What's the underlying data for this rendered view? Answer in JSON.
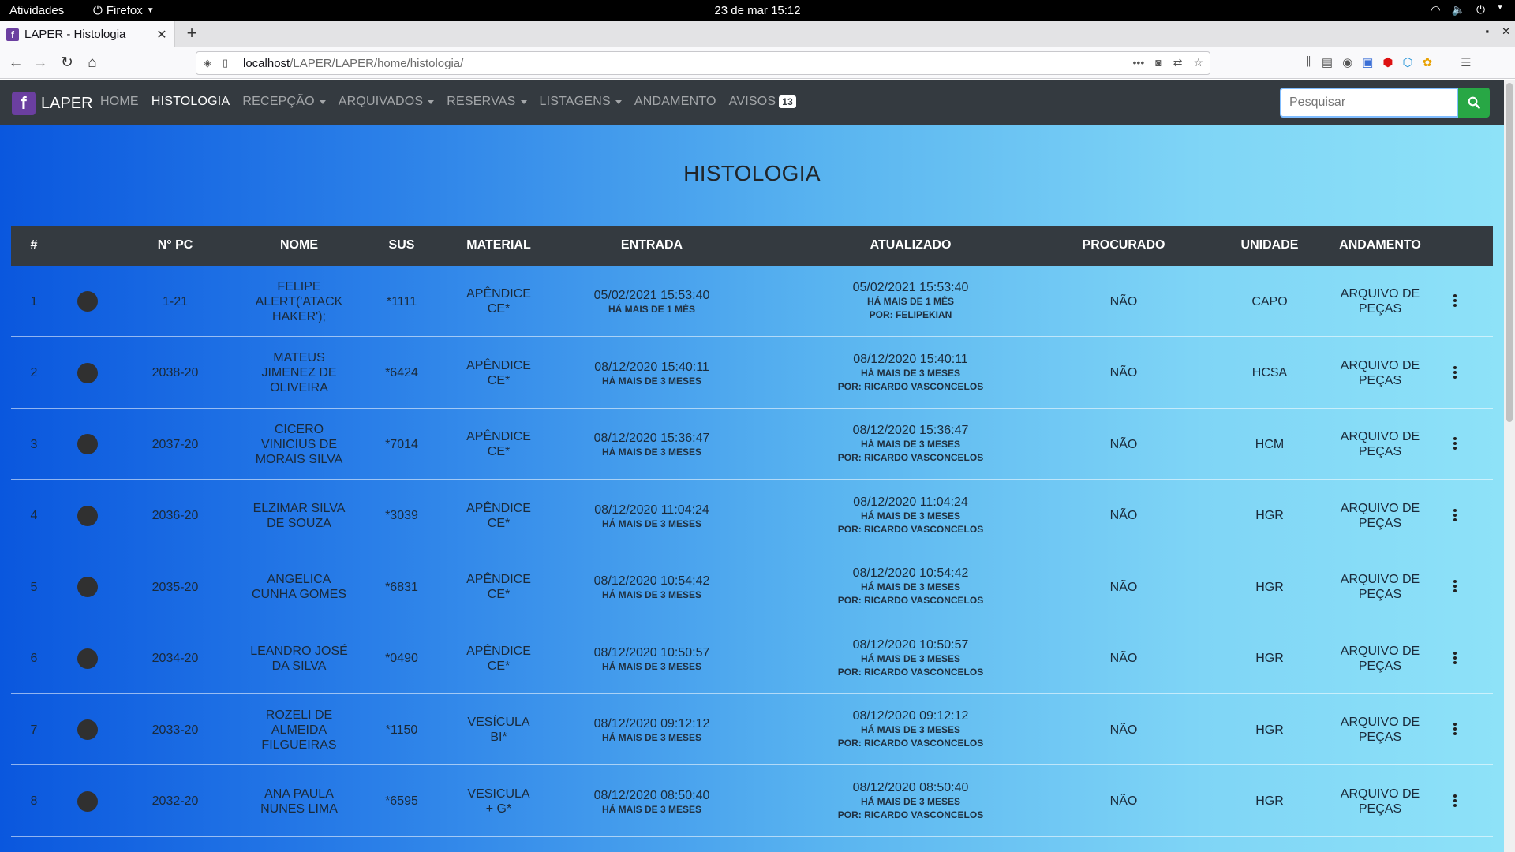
{
  "system_bar": {
    "activities": "Atividades",
    "app_name": "Firefox",
    "clock": "23 de mar  15:12"
  },
  "browser": {
    "tab_title": "LAPER - Histologia",
    "favicon_letter": "f",
    "url_host": "localhost",
    "url_path": "/LAPER/LAPER/home/histologia/"
  },
  "app": {
    "brand": "LAPER",
    "logo_letter": "f",
    "nav": [
      {
        "label": "HOME"
      },
      {
        "label": "HISTOLOGIA"
      },
      {
        "label": "RECEPÇÃO"
      },
      {
        "label": "ARQUIVADOS"
      },
      {
        "label": "RESERVAS"
      },
      {
        "label": "LISTAGENS"
      },
      {
        "label": "ANDAMENTO"
      },
      {
        "label": "AVISOS",
        "badge": "13"
      }
    ],
    "search_placeholder": "Pesquisar",
    "page_title": "HISTOLOGIA"
  },
  "colors": {
    "navbar": "#343a40",
    "search_button": "#28a745",
    "gradient_start": "#0a57de",
    "gradient_end": "#8ee2f8"
  },
  "table": {
    "headers": [
      "#",
      "N° PC",
      "NOME",
      "SUS",
      "MATERIAL",
      "ENTRADA",
      "ATUALIZADO",
      "PROCURADO",
      "UNIDADE",
      "ANDAMENTO"
    ],
    "rows": [
      {
        "n": "1",
        "pc": "1-21",
        "nome": [
          "FELIPE",
          "ALERT('ATACK",
          "HAKER');"
        ],
        "sus": "*1111",
        "material": [
          "APÊNDICE",
          "CE*"
        ],
        "entrada": "05/02/2021 15:53:40",
        "entrada_rel": "HÁ MAIS DE 1 MÊS",
        "atualizado": "05/02/2021 15:53:40",
        "atualizado_rel": "HÁ MAIS DE 1 MÊS",
        "por": "POR: FELIPEKIAN",
        "procurado": "NÃO",
        "unidade": "CAPO",
        "andamento": [
          "ARQUIVO DE",
          "PEÇAS"
        ]
      },
      {
        "n": "2",
        "pc": "2038-20",
        "nome": [
          "MATEUS",
          "JIMENEZ DE",
          "OLIVEIRA"
        ],
        "sus": "*6424",
        "material": [
          "APÊNDICE",
          "CE*"
        ],
        "entrada": "08/12/2020 15:40:11",
        "entrada_rel": "HÁ MAIS DE 3 MESES",
        "atualizado": "08/12/2020 15:40:11",
        "atualizado_rel": "HÁ MAIS DE 3 MESES",
        "por": "POR: RICARDO VASCONCELOS",
        "procurado": "NÃO",
        "unidade": "HCSA",
        "andamento": [
          "ARQUIVO DE",
          "PEÇAS"
        ]
      },
      {
        "n": "3",
        "pc": "2037-20",
        "nome": [
          "CICERO",
          "VINICIUS DE",
          "MORAIS SILVA"
        ],
        "sus": "*7014",
        "material": [
          "APÊNDICE",
          "CE*"
        ],
        "entrada": "08/12/2020 15:36:47",
        "entrada_rel": "HÁ MAIS DE 3 MESES",
        "atualizado": "08/12/2020 15:36:47",
        "atualizado_rel": "HÁ MAIS DE 3 MESES",
        "por": "POR: RICARDO VASCONCELOS",
        "procurado": "NÃO",
        "unidade": "HCM",
        "andamento": [
          "ARQUIVO DE",
          "PEÇAS"
        ]
      },
      {
        "n": "4",
        "pc": "2036-20",
        "nome": [
          "ELZIMAR SILVA",
          "DE SOUZA"
        ],
        "sus": "*3039",
        "material": [
          "APÊNDICE",
          "CE*"
        ],
        "entrada": "08/12/2020 11:04:24",
        "entrada_rel": "HÁ MAIS DE 3 MESES",
        "atualizado": "08/12/2020 11:04:24",
        "atualizado_rel": "HÁ MAIS DE 3 MESES",
        "por": "POR: RICARDO VASCONCELOS",
        "procurado": "NÃO",
        "unidade": "HGR",
        "andamento": [
          "ARQUIVO DE",
          "PEÇAS"
        ]
      },
      {
        "n": "5",
        "pc": "2035-20",
        "nome": [
          "ANGELICA",
          "CUNHA GOMES"
        ],
        "sus": "*6831",
        "material": [
          "APÊNDICE",
          "CE*"
        ],
        "entrada": "08/12/2020 10:54:42",
        "entrada_rel": "HÁ MAIS DE 3 MESES",
        "atualizado": "08/12/2020 10:54:42",
        "atualizado_rel": "HÁ MAIS DE 3 MESES",
        "por": "POR: RICARDO VASCONCELOS",
        "procurado": "NÃO",
        "unidade": "HGR",
        "andamento": [
          "ARQUIVO DE",
          "PEÇAS"
        ]
      },
      {
        "n": "6",
        "pc": "2034-20",
        "nome": [
          "LEANDRO JOSÉ",
          "DA SILVA"
        ],
        "sus": "*0490",
        "material": [
          "APÊNDICE",
          "CE*"
        ],
        "entrada": "08/12/2020 10:50:57",
        "entrada_rel": "HÁ MAIS DE 3 MESES",
        "atualizado": "08/12/2020 10:50:57",
        "atualizado_rel": "HÁ MAIS DE 3 MESES",
        "por": "POR: RICARDO VASCONCELOS",
        "procurado": "NÃO",
        "unidade": "HGR",
        "andamento": [
          "ARQUIVO DE",
          "PEÇAS"
        ]
      },
      {
        "n": "7",
        "pc": "2033-20",
        "nome": [
          "ROZELI DE",
          "ALMEIDA",
          "FILGUEIRAS"
        ],
        "sus": "*1150",
        "material": [
          "VESÍCULA",
          "BI*"
        ],
        "entrada": "08/12/2020 09:12:12",
        "entrada_rel": "HÁ MAIS DE 3 MESES",
        "atualizado": "08/12/2020 09:12:12",
        "atualizado_rel": "HÁ MAIS DE 3 MESES",
        "por": "POR: RICARDO VASCONCELOS",
        "procurado": "NÃO",
        "unidade": "HGR",
        "andamento": [
          "ARQUIVO DE",
          "PEÇAS"
        ]
      },
      {
        "n": "8",
        "pc": "2032-20",
        "nome": [
          "ANA PAULA",
          "NUNES LIMA"
        ],
        "sus": "*6595",
        "material": [
          "VESICULA",
          "+ G*"
        ],
        "entrada": "08/12/2020 08:50:40",
        "entrada_rel": "HÁ MAIS DE 3 MESES",
        "atualizado": "08/12/2020 08:50:40",
        "atualizado_rel": "HÁ MAIS DE 3 MESES",
        "por": "POR: RICARDO VASCONCELOS",
        "procurado": "NÃO",
        "unidade": "HGR",
        "andamento": [
          "ARQUIVO DE",
          "PEÇAS"
        ]
      }
    ]
  }
}
